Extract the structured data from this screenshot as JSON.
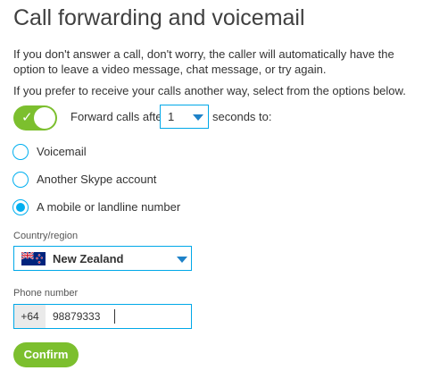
{
  "page": {
    "title": "Call forwarding and voicemail",
    "intro_1": "If you don't answer a call, don't worry, the caller will automatically have the option to leave a video message, chat message, or try again.",
    "intro_2": "If you prefer to receive your calls another way, select from the options below."
  },
  "forwarding": {
    "enabled": true,
    "label": "Forward calls after",
    "seconds_value": "1",
    "seconds_suffix": "seconds to:"
  },
  "options": [
    {
      "label": "Voicemail",
      "selected": false
    },
    {
      "label": "Another Skype account",
      "selected": false
    },
    {
      "label": "A mobile or landline number",
      "selected": true
    }
  ],
  "country": {
    "label": "Country/region",
    "value": "New Zealand"
  },
  "phone": {
    "label": "Phone number",
    "prefix": "+64",
    "value": "98879333"
  },
  "confirm_label": "Confirm",
  "colors": {
    "accent_green": "#7cbf2e",
    "accent_blue": "#00aff0"
  }
}
